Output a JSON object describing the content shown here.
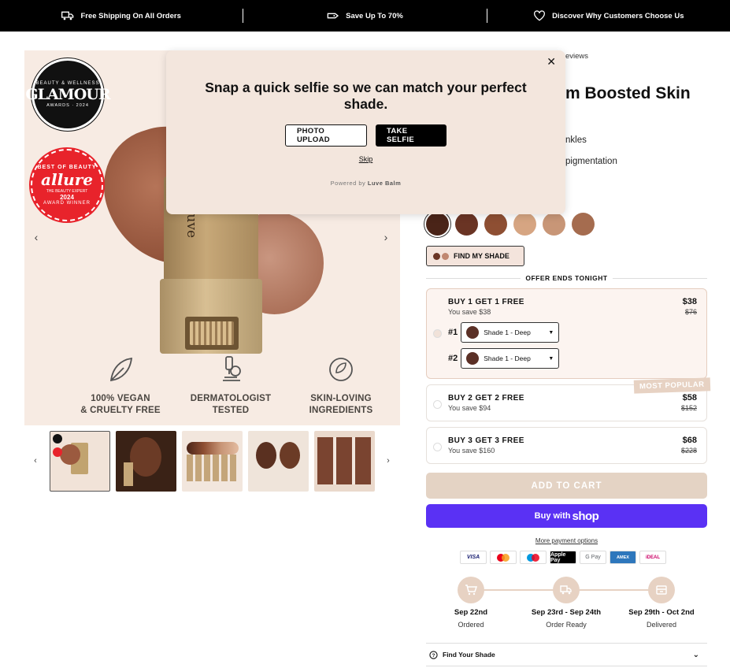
{
  "announcement": {
    "items": [
      {
        "label": "Free Shipping On All Orders",
        "icon": "truck-icon"
      },
      {
        "label": "Save Up To 70%",
        "icon": "tag-icon"
      },
      {
        "label": "Discover Why Customers Choose Us",
        "icon": "heart-icon"
      }
    ]
  },
  "gallery": {
    "badge_glamour": {
      "top": "BEAUTY & WELLNESS",
      "name": "GLAMOUR",
      "bottom": "AWARDS · 2024"
    },
    "badge_allure": {
      "top": "BEST OF BEAUTY",
      "name": "allure",
      "sub": "THE BEAUTY EXPERT",
      "year": "2024",
      "bottom": "AWARD WINNER"
    },
    "brand": "luve",
    "features": [
      {
        "line1": "100% VEGAN",
        "line2": "& CRUELTY FREE",
        "icon": "leaf-icon"
      },
      {
        "line1": "DERMATOLOGIST",
        "line2": "TESTED",
        "icon": "microscope-icon"
      },
      {
        "line1": "SKIN-LOVING",
        "line2": "INGREDIENTS",
        "icon": "recycle-leaf-icon"
      }
    ]
  },
  "modal": {
    "heading": "Snap a quick selfie so we can match your perfect shade.",
    "upload_label": "PHOTO UPLOAD",
    "selfie_label": "TAKE SELFIE",
    "skip_label": "Skip",
    "powered_prefix": "Powered by",
    "powered_brand": "Luve Balm"
  },
  "product": {
    "reviews_text": "eviews",
    "title": "m Boosted Skin",
    "bullets": [
      "nkles",
      "pigmentation"
    ],
    "shade_colors": [
      "#4a2418",
      "#6a3424",
      "#8e4f33",
      "#d6a582",
      "#c89677",
      "#a56c4f"
    ],
    "find_shade_label": "FIND MY SHADE",
    "find_shade_dots": [
      "#6a3424",
      "#c08770"
    ],
    "offer_label": "OFFER ENDS TONIGHT",
    "options": [
      {
        "name": "BUY 1 GET 1 FREE",
        "save": "You save $38",
        "price": "$38",
        "old": "$76"
      },
      {
        "name": "BUY 2 GET 2 FREE",
        "save": "You save $94",
        "price": "$58",
        "old": "$152"
      },
      {
        "name": "BUY 3 GET 3 FREE",
        "save": "You save $160",
        "price": "$68",
        "old": "$228"
      }
    ],
    "selectors": [
      {
        "index": "#1",
        "value": "Shade 1 - Deep"
      },
      {
        "index": "#2",
        "value": "Shade 1 - Deep"
      }
    ],
    "popular_label": "MOST POPULAR",
    "add_to_cart": "ADD TO CART",
    "shop_pay_prefix": "Buy with",
    "shop_pay_logo": "shop",
    "more_payment": "More payment options",
    "payments": [
      "VISA",
      "MC",
      "Maestro",
      "Apple Pay",
      "G Pay",
      "AMEX",
      "iDEAL"
    ],
    "timeline": [
      {
        "date": "Sep 22nd",
        "label": "Ordered",
        "icon": "cart-icon"
      },
      {
        "date": "Sep 23rd - Sep 24th",
        "label": "Order Ready",
        "icon": "truck-icon"
      },
      {
        "date": "Sep 29th - Oct 2nd",
        "label": "Delivered",
        "icon": "package-icon"
      }
    ],
    "accordion_label": "Find Your Shade"
  }
}
